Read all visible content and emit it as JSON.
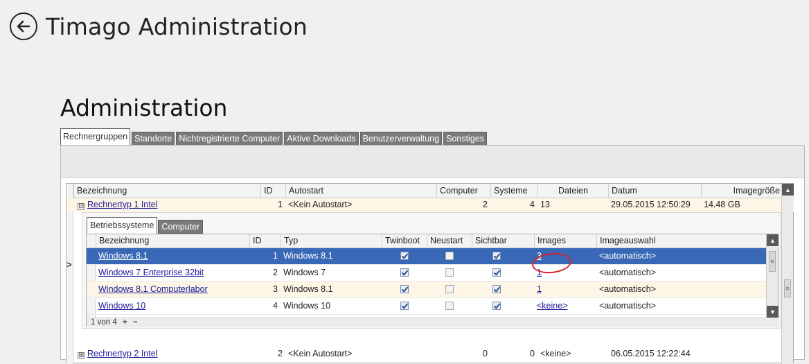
{
  "app": {
    "title": "Timago Administration"
  },
  "page": {
    "title": "Administration"
  },
  "tabs": [
    "Rechnergruppen",
    "Standorte",
    "Nichtregistrierte Computer",
    "Aktive Downloads",
    "Benutzerverwaltung",
    "Sonstiges"
  ],
  "groups_table": {
    "columns": [
      "Bezeichnung",
      "ID",
      "Autostart",
      "Computer",
      "Systeme",
      "Dateien",
      "Datum",
      "Imagegröße"
    ],
    "rows": [
      {
        "expander": "⊟",
        "bezeichnung": "Rechnertyp 1 Intel",
        "id": "1",
        "autostart": "<Kein Autostart>",
        "computer": "2",
        "systeme": "4",
        "dateien": "13",
        "datum": "29.05.2015 12:50:29",
        "imagegroesse": "14.48 GB"
      },
      {
        "expander": "⊞",
        "bezeichnung": "Rechnertyp 2 Intel",
        "id": "2",
        "autostart": "<Kein Autostart>",
        "computer": "0",
        "systeme": "0",
        "dateien": "<keine>",
        "datum": "06.05.2015 12:22:44",
        "imagegroesse": ""
      }
    ]
  },
  "detail": {
    "tabs": [
      "Betriebssysteme",
      "Computer"
    ],
    "columns": [
      "Bezeichnung",
      "ID",
      "Typ",
      "Twinboot",
      "Neustart",
      "Sichtbar",
      "Images",
      "Imageauswahl"
    ],
    "rows": [
      {
        "bezeichnung": "Windows 8.1",
        "id": "1",
        "typ": "Windows 8.1",
        "twinboot": true,
        "neustart": false,
        "sichtbar": true,
        "images": "3",
        "imageauswahl": "<automatisch>"
      },
      {
        "bezeichnung": "Windows 7 Enterprise 32bit",
        "id": "2",
        "typ": "Windows 7",
        "twinboot": true,
        "neustart": false,
        "sichtbar": true,
        "images": "1",
        "imageauswahl": "<automatisch>"
      },
      {
        "bezeichnung": "Windows 8.1 Computerlabor",
        "id": "3",
        "typ": "Windows 8.1",
        "twinboot": true,
        "neustart": false,
        "sichtbar": true,
        "images": "1",
        "imageauswahl": "<automatisch>"
      },
      {
        "bezeichnung": "Windows 10",
        "id": "4",
        "typ": "Windows 10",
        "twinboot": true,
        "neustart": false,
        "sichtbar": true,
        "images": "<keine>",
        "imageauswahl": "<automatisch>"
      }
    ],
    "pager": {
      "text": "1 von 4",
      "add": "+",
      "remove": "−"
    }
  },
  "colors": {
    "selection": "#3968b6",
    "highlight_ring": "#d8222b",
    "tab_inactive": "#7a7a7a",
    "alt_row": "#fdf5e6"
  }
}
